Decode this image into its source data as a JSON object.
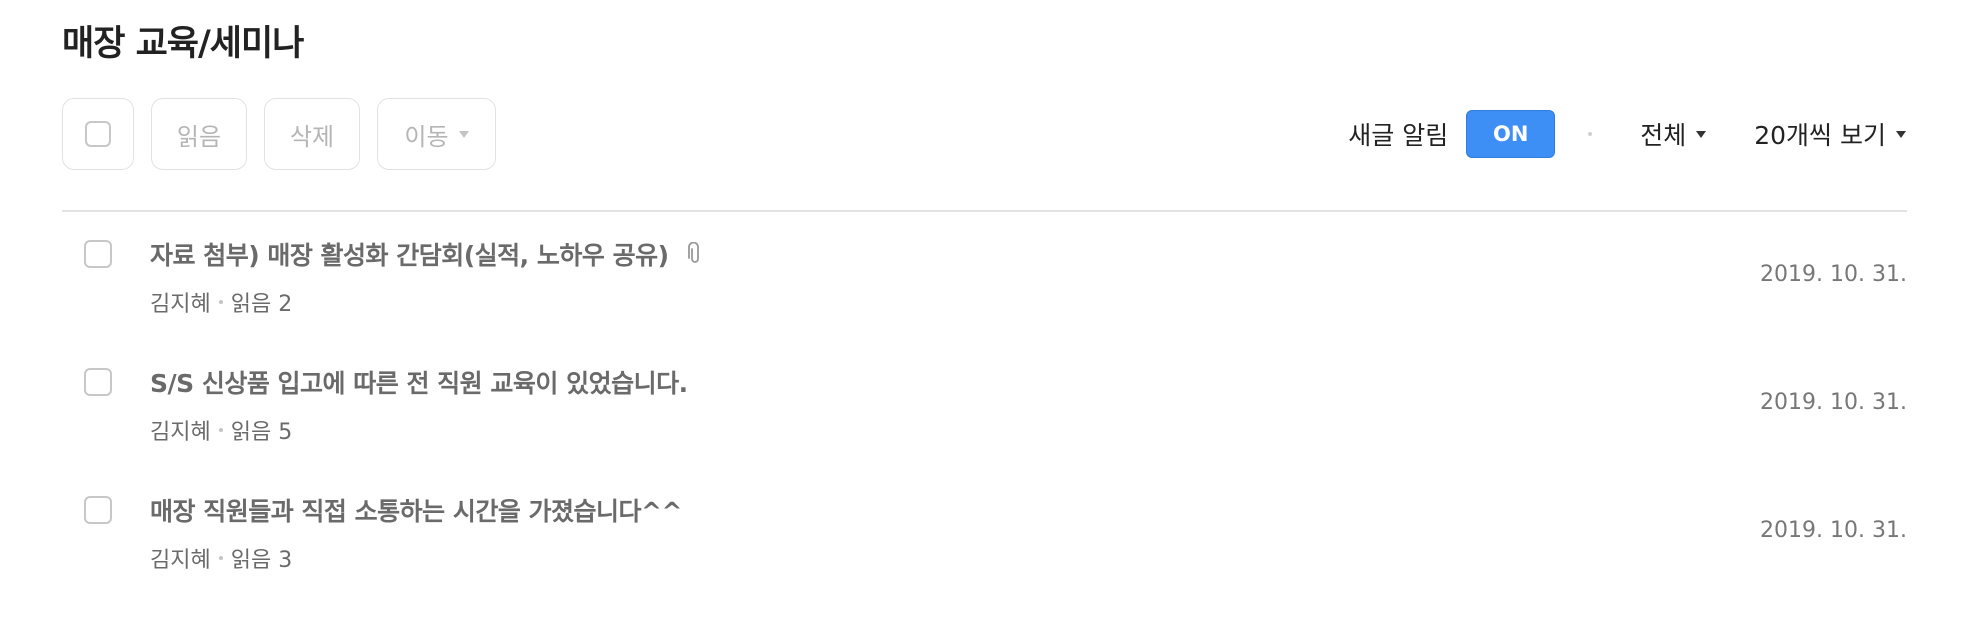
{
  "page": {
    "title": "매장 교육/세미나"
  },
  "toolbar": {
    "read_label": "읽음",
    "delete_label": "삭제",
    "move_label": "이동",
    "notify_label": "새글 알림",
    "notify_state": "ON",
    "filter_label": "전체",
    "page_size_label": "20개씩 보기"
  },
  "posts": [
    {
      "title": "자료 첨부) 매장 활성화 간담회(실적, 노하우 공유)",
      "has_attachment": true,
      "author": "김지혜",
      "read_label": "읽음 2",
      "date": "2019. 10. 31."
    },
    {
      "title": "S/S 신상품 입고에 따른 전 직원 교육이 있었습니다.",
      "has_attachment": false,
      "author": "김지혜",
      "read_label": "읽음 5",
      "date": "2019. 10. 31."
    },
    {
      "title": "매장 직원들과 직접 소통하는 시간을 가졌습니다^^",
      "has_attachment": false,
      "author": "김지혜",
      "read_label": "읽음 3",
      "date": "2019. 10. 31."
    }
  ],
  "colors": {
    "accent": "#3d8ef5",
    "title_text": "#222222",
    "post_text": "#6a6a6a",
    "border": "#e2e2e2"
  }
}
